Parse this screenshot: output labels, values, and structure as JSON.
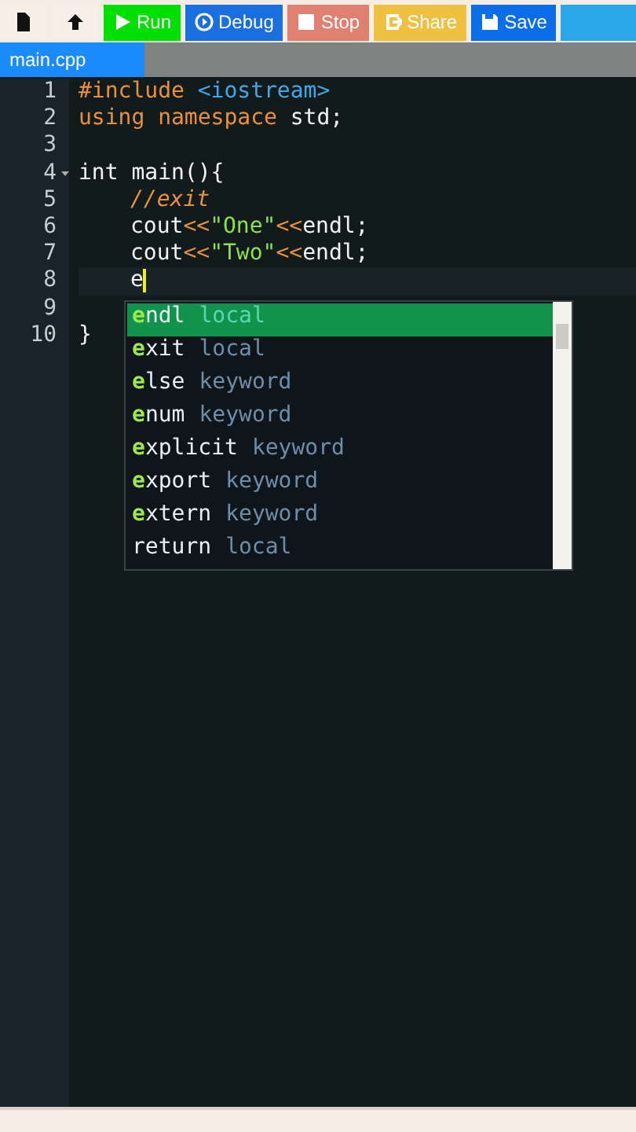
{
  "toolbar": {
    "buttons": [
      {
        "kind": "new-file"
      },
      {
        "kind": "upload"
      },
      {
        "kind": "run",
        "label": "Run"
      },
      {
        "kind": "debug",
        "label": "Debug"
      },
      {
        "kind": "stop",
        "label": "Stop"
      },
      {
        "kind": "share",
        "label": "Share"
      },
      {
        "kind": "save",
        "label": "Save"
      },
      {
        "kind": "more"
      }
    ]
  },
  "tabs": [
    {
      "label": "main.cpp",
      "selected": true
    }
  ],
  "editor": {
    "lines": [
      {
        "number": "1",
        "tokens": [
          {
            "kind": "keyword",
            "text": "#include "
          },
          {
            "kind": "include",
            "text": "<iostream>"
          }
        ]
      },
      {
        "number": "2",
        "tokens": [
          {
            "kind": "keyword",
            "text": "using namespace"
          },
          {
            "kind": "plain",
            "text": " std;"
          }
        ]
      },
      {
        "number": "3"
      },
      {
        "number": "4",
        "foldable": true,
        "tokens": [
          {
            "kind": "plain",
            "text": "int main(){"
          }
        ]
      },
      {
        "number": "5",
        "indented": true,
        "tokens": [
          {
            "kind": "comment",
            "text": "//exit"
          }
        ]
      },
      {
        "number": "6",
        "indented": true,
        "tokens": [
          {
            "kind": "plain",
            "text": "cout"
          },
          {
            "kind": "operator",
            "text": "<<"
          },
          {
            "kind": "string",
            "text": "\"One\""
          },
          {
            "kind": "operator",
            "text": "<<"
          },
          {
            "kind": "plain",
            "text": "endl;"
          }
        ]
      },
      {
        "number": "7",
        "indented": true,
        "tokens": [
          {
            "kind": "plain",
            "text": "cout"
          },
          {
            "kind": "operator",
            "text": "<<"
          },
          {
            "kind": "string",
            "text": "\"Two\""
          },
          {
            "kind": "operator",
            "text": "<<"
          },
          {
            "kind": "plain",
            "text": "endl;"
          }
        ]
      },
      {
        "number": "8",
        "indented": true,
        "cursor": true,
        "tokens": [
          {
            "kind": "plain",
            "text": "e"
          }
        ]
      },
      {
        "number": "9"
      },
      {
        "number": "10",
        "tokens": [
          {
            "kind": "plain",
            "text": "}"
          }
        ]
      }
    ],
    "autocomplete": [
      {
        "match": "e",
        "rest": "ndl",
        "meta": "local",
        "selected": true
      },
      {
        "match": "e",
        "rest": "xit",
        "meta": "local",
        "selected": false
      },
      {
        "match": "e",
        "rest": "lse",
        "meta": "keyword",
        "selected": false
      },
      {
        "match": "e",
        "rest": "num",
        "meta": "keyword",
        "selected": false
      },
      {
        "match": "e",
        "rest": "xplicit",
        "meta": "keyword",
        "selected": false
      },
      {
        "match": "e",
        "rest": "xport",
        "meta": "keyword",
        "selected": false
      },
      {
        "match": "e",
        "rest": "xtern",
        "meta": "keyword",
        "selected": false
      },
      {
        "rest": "return",
        "meta": "local",
        "selected": false
      }
    ]
  }
}
